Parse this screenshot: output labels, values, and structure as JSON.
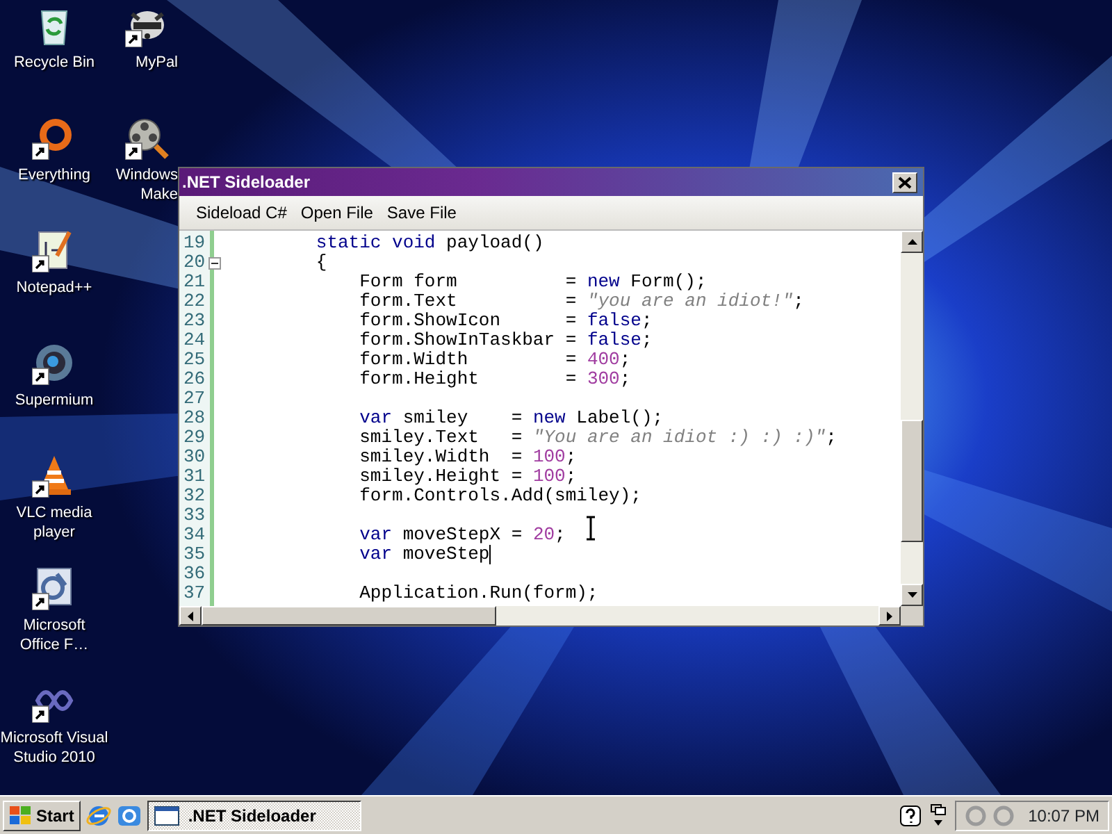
{
  "desktop": {
    "columns": [
      {
        "icons": [
          {
            "kind": "recycle",
            "lines": [
              "Recycle Bin"
            ],
            "shortcut": false
          },
          {
            "kind": "everything",
            "lines": [
              "Everything"
            ],
            "shortcut": true
          },
          {
            "kind": "notepad",
            "lines": [
              "Notepad++"
            ],
            "shortcut": true
          },
          {
            "kind": "browser",
            "lines": [
              "Supermium"
            ],
            "shortcut": true
          },
          {
            "kind": "cone",
            "lines": [
              "VLC media",
              "player"
            ],
            "shortcut": true
          },
          {
            "kind": "office",
            "lines": [
              "Microsoft",
              "Office F…"
            ],
            "shortcut": true
          },
          {
            "kind": "studio",
            "lines": [
              "Microsoft Visual",
              "Studio 2010"
            ],
            "shortcut": true
          }
        ]
      },
      {
        "icons": [
          {
            "kind": "raccoon",
            "lines": [
              "MyPal"
            ],
            "shortcut": true
          },
          {
            "kind": "film",
            "lines": [
              "Windows",
              "Make"
            ],
            "shortcut": true
          }
        ]
      }
    ]
  },
  "window": {
    "title": ".NET Sideloader",
    "menu": [
      "Sideload C#",
      "Open File",
      "Save File"
    ],
    "editor": {
      "lines": [
        {
          "number": "19",
          "fold": false,
          "caret": false,
          "tokens": [
            {
              "kind": "keyword",
              "text": "static void"
            },
            {
              "kind": "plain",
              "text": " payload()"
            }
          ]
        },
        {
          "number": "20",
          "fold": true,
          "caret": false,
          "tokens": [
            {
              "kind": "plain",
              "text": "{"
            }
          ],
          "children": [
            {
              "number": "21",
              "fold": false,
              "caret": false,
              "tokens": [
                {
                  "kind": "plain",
                  "text": "Form form          = "
                },
                {
                  "kind": "keyword",
                  "text": "new"
                },
                {
                  "kind": "plain",
                  "text": " Form();"
                }
              ]
            },
            {
              "number": "22",
              "fold": false,
              "caret": false,
              "tokens": [
                {
                  "kind": "plain",
                  "text": "form.Text          = "
                },
                {
                  "kind": "string",
                  "text": "\"you are an idiot!\""
                },
                {
                  "kind": "plain",
                  "text": ";"
                }
              ]
            },
            {
              "number": "23",
              "fold": false,
              "caret": false,
              "tokens": [
                {
                  "kind": "plain",
                  "text": "form.ShowIcon      = "
                },
                {
                  "kind": "keyword",
                  "text": "false"
                },
                {
                  "kind": "plain",
                  "text": ";"
                }
              ]
            },
            {
              "number": "24",
              "fold": false,
              "caret": false,
              "tokens": [
                {
                  "kind": "plain",
                  "text": "form.ShowInTaskbar = "
                },
                {
                  "kind": "keyword",
                  "text": "false"
                },
                {
                  "kind": "plain",
                  "text": ";"
                }
              ]
            },
            {
              "number": "25",
              "fold": false,
              "caret": false,
              "tokens": [
                {
                  "kind": "plain",
                  "text": "form.Width         = "
                },
                {
                  "kind": "number",
                  "text": "400"
                },
                {
                  "kind": "plain",
                  "text": ";"
                }
              ]
            },
            {
              "number": "26",
              "fold": false,
              "caret": false,
              "tokens": [
                {
                  "kind": "plain",
                  "text": "form.Height        = "
                },
                {
                  "kind": "number",
                  "text": "300"
                },
                {
                  "kind": "plain",
                  "text": ";"
                }
              ]
            },
            {
              "number": "27",
              "fold": false,
              "caret": false
            },
            {
              "number": "28",
              "fold": false,
              "caret": false,
              "tokens": [
                {
                  "kind": "keyword",
                  "text": "var"
                },
                {
                  "kind": "plain",
                  "text": " smiley    = "
                },
                {
                  "kind": "keyword",
                  "text": "new"
                },
                {
                  "kind": "plain",
                  "text": " Label();"
                }
              ]
            },
            {
              "number": "29",
              "fold": false,
              "caret": false,
              "tokens": [
                {
                  "kind": "plain",
                  "text": "smiley.Text   = "
                },
                {
                  "kind": "string",
                  "text": "\"You are an idiot :) :) :)\""
                },
                {
                  "kind": "plain",
                  "text": ";"
                }
              ]
            },
            {
              "number": "30",
              "fold": false,
              "caret": false,
              "tokens": [
                {
                  "kind": "plain",
                  "text": "smiley.Width  = "
                },
                {
                  "kind": "number",
                  "text": "100"
                },
                {
                  "kind": "plain",
                  "text": ";"
                }
              ]
            },
            {
              "number": "31",
              "fold": false,
              "caret": false,
              "tokens": [
                {
                  "kind": "plain",
                  "text": "smiley.Height = "
                },
                {
                  "kind": "number",
                  "text": "100"
                },
                {
                  "kind": "plain",
                  "text": ";"
                }
              ]
            },
            {
              "number": "32",
              "fold": false,
              "caret": false,
              "tokens": [
                {
                  "kind": "plain",
                  "text": "form.Controls.Add(smiley);"
                }
              ]
            },
            {
              "number": "33",
              "fold": false,
              "caret": false
            },
            {
              "number": "34",
              "fold": false,
              "caret": false,
              "tokens": [
                {
                  "kind": "keyword",
                  "text": "var"
                },
                {
                  "kind": "plain",
                  "text": " moveStepX = "
                },
                {
                  "kind": "number",
                  "text": "20"
                },
                {
                  "kind": "plain",
                  "text": ";"
                }
              ]
            },
            {
              "number": "35",
              "fold": false,
              "caret": true,
              "tokens": [
                {
                  "kind": "keyword",
                  "text": "var"
                },
                {
                  "kind": "plain",
                  "text": " moveStep"
                }
              ]
            },
            {
              "number": "36",
              "fold": false,
              "caret": false
            },
            {
              "number": "37",
              "fold": false,
              "caret": false,
              "tokens": [
                {
                  "kind": "plain",
                  "text": "Application.Run(form);"
                }
              ]
            }
          ]
        }
      ]
    }
  },
  "taskbar": {
    "start": "Start",
    "tasks": [
      {
        "label": ".NET Sideloader",
        "selected": true
      }
    ],
    "clock": "10:07 PM"
  }
}
